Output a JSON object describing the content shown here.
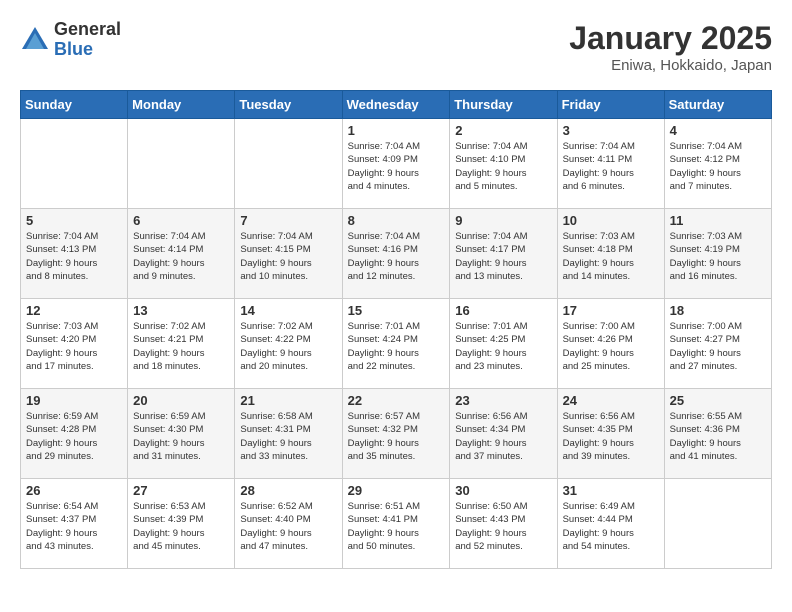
{
  "header": {
    "logo_general": "General",
    "logo_blue": "Blue",
    "title": "January 2025",
    "location": "Eniwa, Hokkaido, Japan"
  },
  "weekdays": [
    "Sunday",
    "Monday",
    "Tuesday",
    "Wednesday",
    "Thursday",
    "Friday",
    "Saturday"
  ],
  "weeks": [
    [
      {
        "day": "",
        "info": ""
      },
      {
        "day": "",
        "info": ""
      },
      {
        "day": "",
        "info": ""
      },
      {
        "day": "1",
        "info": "Sunrise: 7:04 AM\nSunset: 4:09 PM\nDaylight: 9 hours\nand 4 minutes."
      },
      {
        "day": "2",
        "info": "Sunrise: 7:04 AM\nSunset: 4:10 PM\nDaylight: 9 hours\nand 5 minutes."
      },
      {
        "day": "3",
        "info": "Sunrise: 7:04 AM\nSunset: 4:11 PM\nDaylight: 9 hours\nand 6 minutes."
      },
      {
        "day": "4",
        "info": "Sunrise: 7:04 AM\nSunset: 4:12 PM\nDaylight: 9 hours\nand 7 minutes."
      }
    ],
    [
      {
        "day": "5",
        "info": "Sunrise: 7:04 AM\nSunset: 4:13 PM\nDaylight: 9 hours\nand 8 minutes."
      },
      {
        "day": "6",
        "info": "Sunrise: 7:04 AM\nSunset: 4:14 PM\nDaylight: 9 hours\nand 9 minutes."
      },
      {
        "day": "7",
        "info": "Sunrise: 7:04 AM\nSunset: 4:15 PM\nDaylight: 9 hours\nand 10 minutes."
      },
      {
        "day": "8",
        "info": "Sunrise: 7:04 AM\nSunset: 4:16 PM\nDaylight: 9 hours\nand 12 minutes."
      },
      {
        "day": "9",
        "info": "Sunrise: 7:04 AM\nSunset: 4:17 PM\nDaylight: 9 hours\nand 13 minutes."
      },
      {
        "day": "10",
        "info": "Sunrise: 7:03 AM\nSunset: 4:18 PM\nDaylight: 9 hours\nand 14 minutes."
      },
      {
        "day": "11",
        "info": "Sunrise: 7:03 AM\nSunset: 4:19 PM\nDaylight: 9 hours\nand 16 minutes."
      }
    ],
    [
      {
        "day": "12",
        "info": "Sunrise: 7:03 AM\nSunset: 4:20 PM\nDaylight: 9 hours\nand 17 minutes."
      },
      {
        "day": "13",
        "info": "Sunrise: 7:02 AM\nSunset: 4:21 PM\nDaylight: 9 hours\nand 18 minutes."
      },
      {
        "day": "14",
        "info": "Sunrise: 7:02 AM\nSunset: 4:22 PM\nDaylight: 9 hours\nand 20 minutes."
      },
      {
        "day": "15",
        "info": "Sunrise: 7:01 AM\nSunset: 4:24 PM\nDaylight: 9 hours\nand 22 minutes."
      },
      {
        "day": "16",
        "info": "Sunrise: 7:01 AM\nSunset: 4:25 PM\nDaylight: 9 hours\nand 23 minutes."
      },
      {
        "day": "17",
        "info": "Sunrise: 7:00 AM\nSunset: 4:26 PM\nDaylight: 9 hours\nand 25 minutes."
      },
      {
        "day": "18",
        "info": "Sunrise: 7:00 AM\nSunset: 4:27 PM\nDaylight: 9 hours\nand 27 minutes."
      }
    ],
    [
      {
        "day": "19",
        "info": "Sunrise: 6:59 AM\nSunset: 4:28 PM\nDaylight: 9 hours\nand 29 minutes."
      },
      {
        "day": "20",
        "info": "Sunrise: 6:59 AM\nSunset: 4:30 PM\nDaylight: 9 hours\nand 31 minutes."
      },
      {
        "day": "21",
        "info": "Sunrise: 6:58 AM\nSunset: 4:31 PM\nDaylight: 9 hours\nand 33 minutes."
      },
      {
        "day": "22",
        "info": "Sunrise: 6:57 AM\nSunset: 4:32 PM\nDaylight: 9 hours\nand 35 minutes."
      },
      {
        "day": "23",
        "info": "Sunrise: 6:56 AM\nSunset: 4:34 PM\nDaylight: 9 hours\nand 37 minutes."
      },
      {
        "day": "24",
        "info": "Sunrise: 6:56 AM\nSunset: 4:35 PM\nDaylight: 9 hours\nand 39 minutes."
      },
      {
        "day": "25",
        "info": "Sunrise: 6:55 AM\nSunset: 4:36 PM\nDaylight: 9 hours\nand 41 minutes."
      }
    ],
    [
      {
        "day": "26",
        "info": "Sunrise: 6:54 AM\nSunset: 4:37 PM\nDaylight: 9 hours\nand 43 minutes."
      },
      {
        "day": "27",
        "info": "Sunrise: 6:53 AM\nSunset: 4:39 PM\nDaylight: 9 hours\nand 45 minutes."
      },
      {
        "day": "28",
        "info": "Sunrise: 6:52 AM\nSunset: 4:40 PM\nDaylight: 9 hours\nand 47 minutes."
      },
      {
        "day": "29",
        "info": "Sunrise: 6:51 AM\nSunset: 4:41 PM\nDaylight: 9 hours\nand 50 minutes."
      },
      {
        "day": "30",
        "info": "Sunrise: 6:50 AM\nSunset: 4:43 PM\nDaylight: 9 hours\nand 52 minutes."
      },
      {
        "day": "31",
        "info": "Sunrise: 6:49 AM\nSunset: 4:44 PM\nDaylight: 9 hours\nand 54 minutes."
      },
      {
        "day": "",
        "info": ""
      }
    ]
  ]
}
